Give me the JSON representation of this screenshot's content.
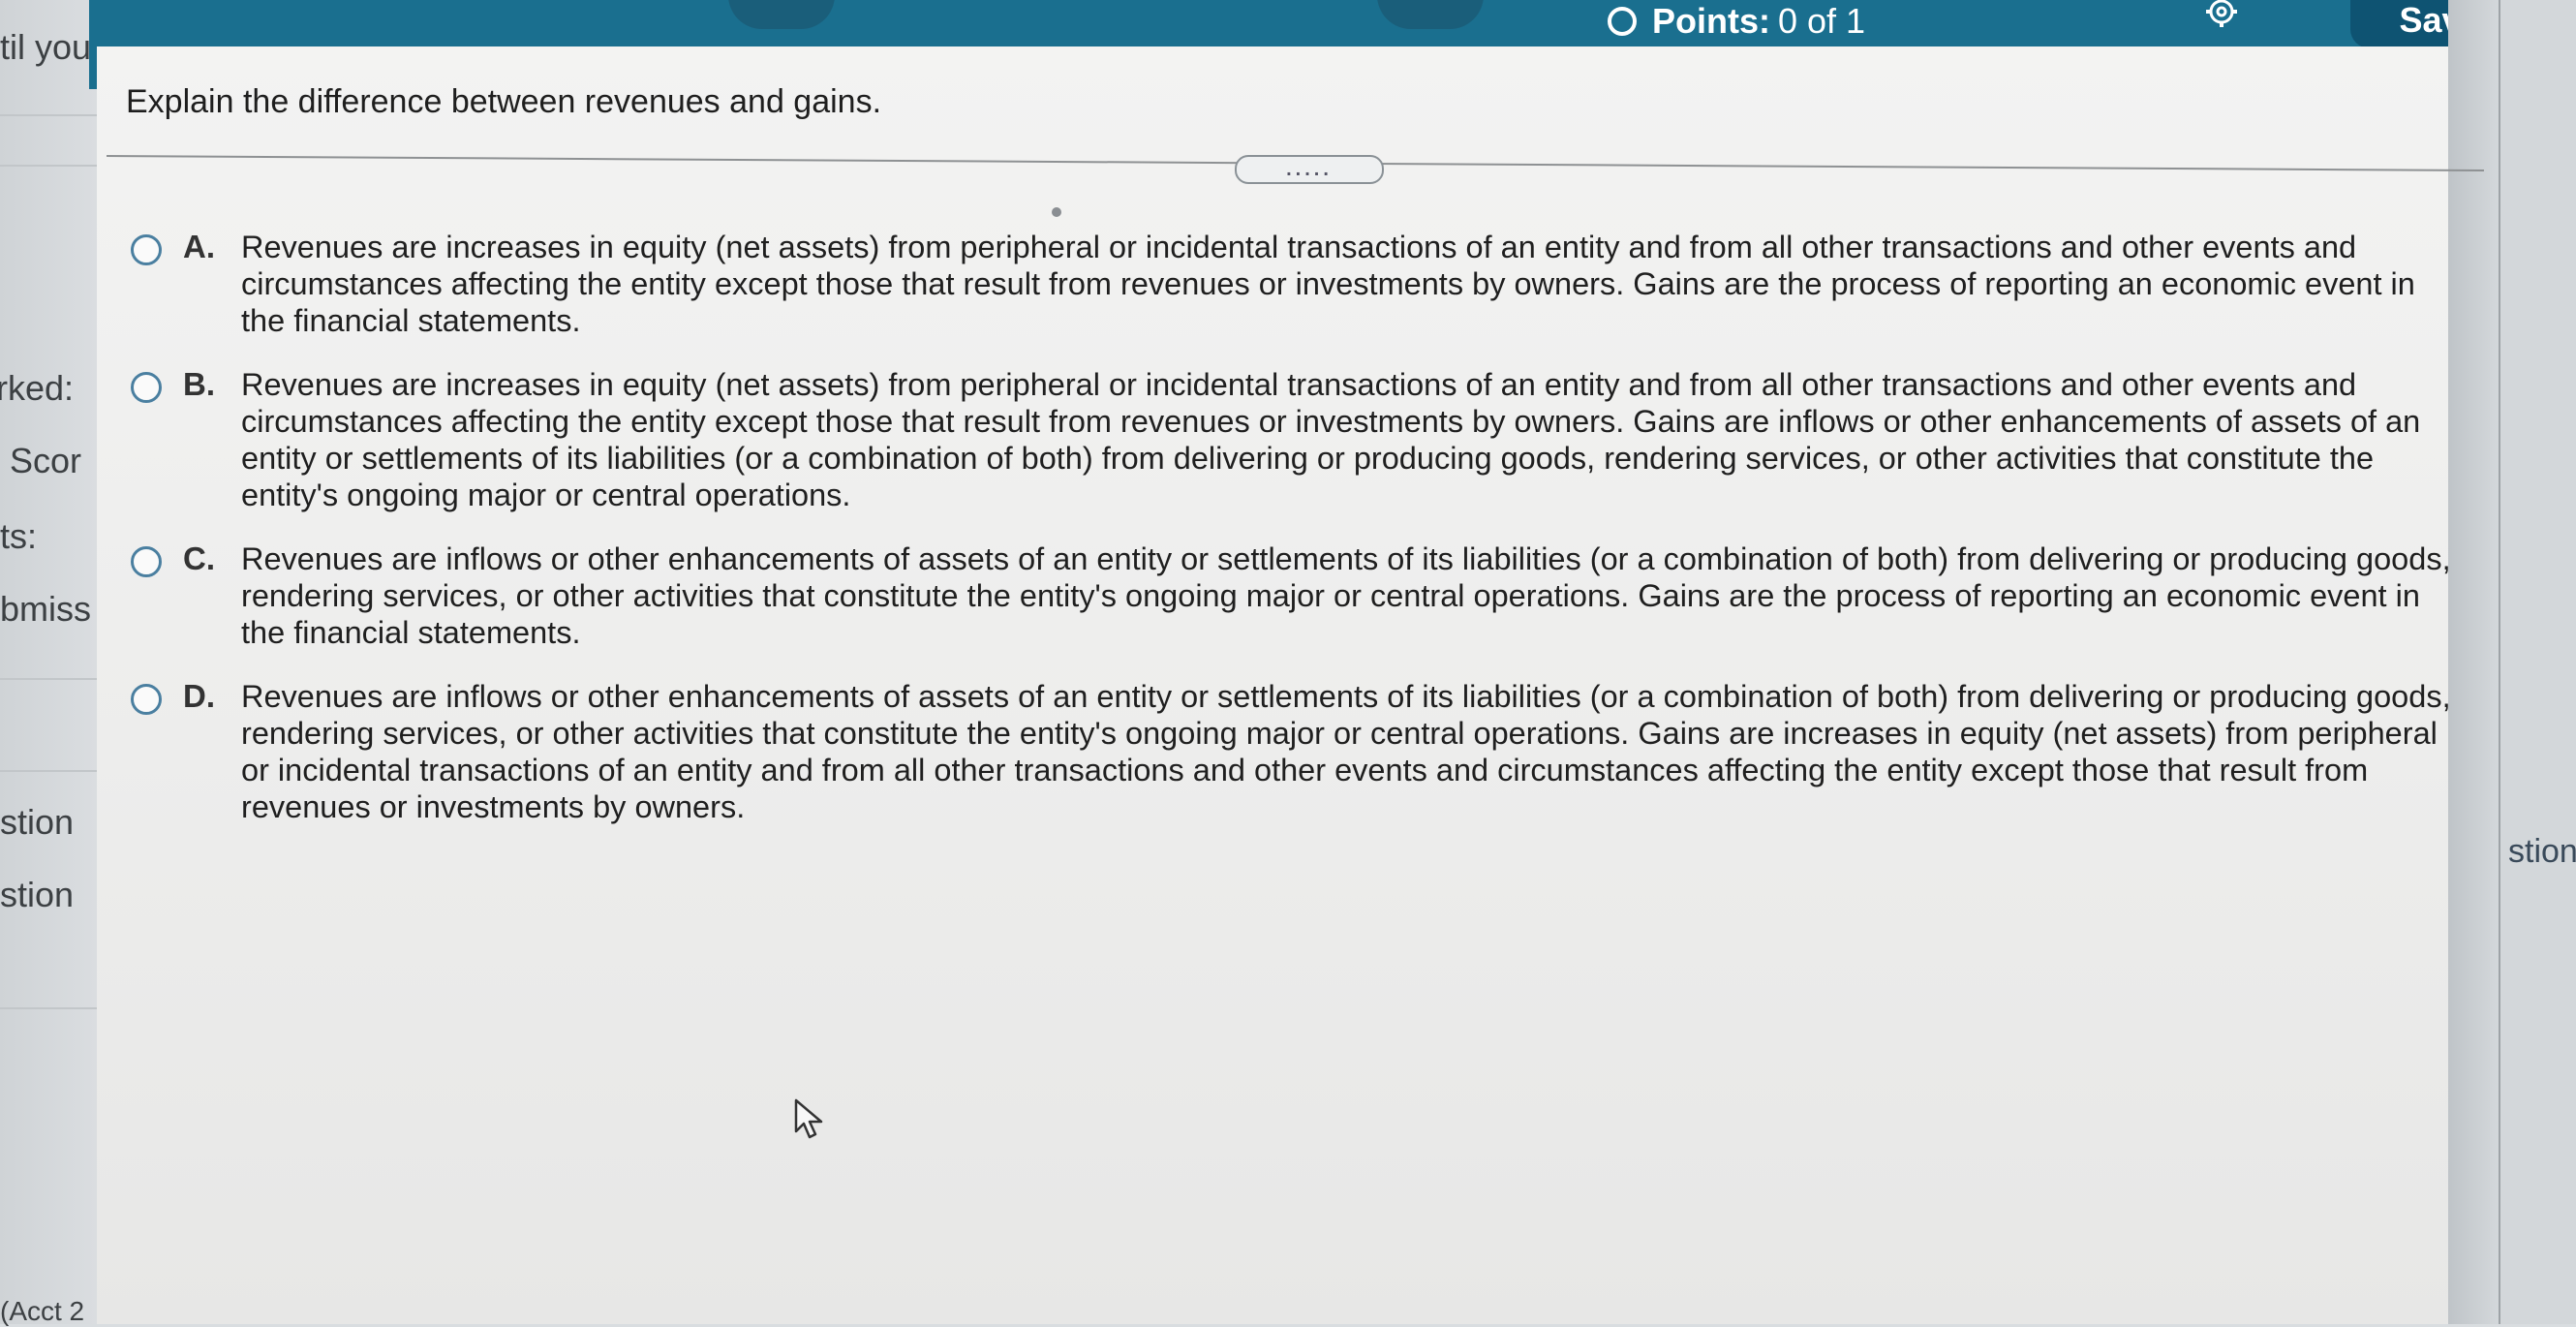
{
  "header": {
    "points_label": "Points:",
    "points_value": "0 of 1",
    "save_label": "Save",
    "settings_icon": "gear-icon",
    "color": "#1a6f8f"
  },
  "left_panel": {
    "fragments": [
      "til you",
      "rked:",
      "Scor",
      "ts:",
      "bmiss",
      "stion",
      "stion",
      "(Acct 2"
    ]
  },
  "right_panel": {
    "fragment": "stion"
  },
  "question": {
    "prompt": "Explain the difference between revenues and gains.",
    "divider_handle": "....."
  },
  "options": [
    {
      "letter": "A.",
      "text": "Revenues are increases in equity (net assets) from peripheral or incidental transactions of an entity and from all other transactions and other events and circumstances affecting the entity except those that result from revenues or investments by owners. Gains are the process of reporting an economic event in the financial statements."
    },
    {
      "letter": "B.",
      "text": "Revenues are increases in equity (net assets) from peripheral or incidental transactions of an entity and from all other transactions and other events and circumstances affecting the entity except those that result from revenues or investments by owners. Gains are inflows or other enhancements of assets of an entity or settlements of its liabilities (or a combination of both) from delivering or producing goods, rendering services, or other activities that constitute the entity's ongoing major or central operations."
    },
    {
      "letter": "C.",
      "text": "Revenues are inflows or other enhancements of assets of an entity or settlements of its liabilities (or a combination of both) from delivering or producing goods, rendering services, or other activities that constitute the entity's ongoing major or central operations. Gains are the process of reporting an economic event in the financial statements."
    },
    {
      "letter": "D.",
      "text": "Revenues are inflows or other enhancements of assets of an entity or settlements of its liabilities (or a combination of both) from delivering or producing goods, rendering services, or other activities that constitute the entity's ongoing major or central operations. Gains are increases in equity (net assets) from peripheral or incidental transactions of an entity and from all other transactions and other events and circumstances affecting the entity except those that result from revenues or investments by owners."
    }
  ]
}
